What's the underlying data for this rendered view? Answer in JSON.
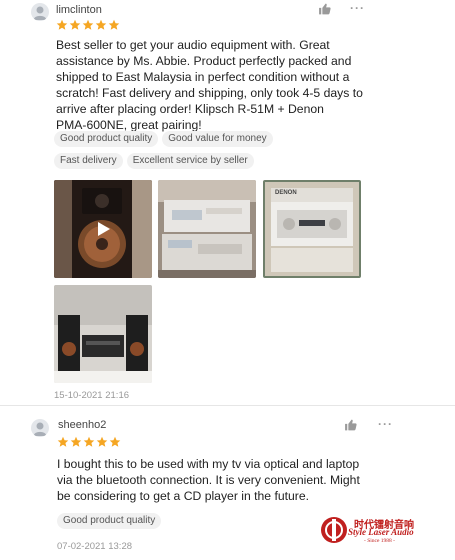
{
  "reviews": [
    {
      "username": "limclinton",
      "rating": 5,
      "lines": [
        "Best seller to get your audio equipment with. Great",
        "assistance by Ms. Abbie. Product perfectly packed and",
        "shipped to East Malaysia in perfect condition without a",
        "scratch! Fast delivery and shipping, only took 4-5 days to",
        "arrive after placing order! Klipsch R-51M + Denon",
        "PMA-600NE, great pairing!"
      ],
      "tags": [
        "Good product quality",
        "Good value for money",
        "Fast delivery",
        "Excellent service by seller"
      ],
      "photos": [
        {
          "icon": "video-play-icon",
          "label": ""
        },
        {
          "label": ""
        },
        {
          "label": "DENON"
        },
        {
          "label": ""
        }
      ],
      "timestamp": "15-10-2021 21:16"
    },
    {
      "username": "sheenho2",
      "rating": 5,
      "lines": [
        "I bought this to be used with my tv via optical and laptop",
        "via the bluetooth connection. It is very convenient. Might",
        "be considering to get a CD player in the future."
      ],
      "tags": [
        "Good product quality"
      ],
      "timestamp": "07-02-2021 13:28"
    }
  ],
  "icons": {
    "like": "thumbs-up-icon",
    "more": "more-options-icon",
    "star": "star-icon",
    "avatar": "user-avatar-icon"
  },
  "more_label": "···",
  "colors": {
    "star": "#f5a623",
    "tag_bg": "#f1f1f1",
    "logo_red": "#c0201f"
  },
  "watermark": {
    "chinese": "时代镭射音响",
    "english": "Style Laser Audio",
    "since": "- Since 1988 -"
  }
}
